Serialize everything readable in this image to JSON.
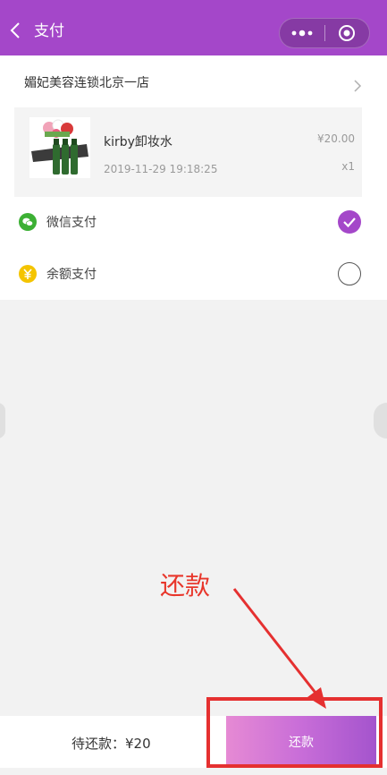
{
  "header": {
    "title": "支付",
    "background": "#a447c9"
  },
  "store": {
    "name": "媚妃美容连锁北京一店"
  },
  "order": {
    "product_name": "kirby卸妆水",
    "time": "2019-11-29 19:18:25",
    "price": "¥20.00",
    "quantity": "x1"
  },
  "payment_methods": [
    {
      "label": "微信支付",
      "icon": "wechat-pay-icon",
      "selected": true,
      "icon_color": "#3cb034"
    },
    {
      "label": "余额支付",
      "icon": "balance-yuan-icon",
      "selected": false,
      "icon_color": "#f4c400"
    }
  ],
  "annotation": {
    "label": "还款",
    "color": "#e8362b"
  },
  "bottom_bar": {
    "due_text": "待还款：¥20",
    "repay_label": "还款"
  }
}
